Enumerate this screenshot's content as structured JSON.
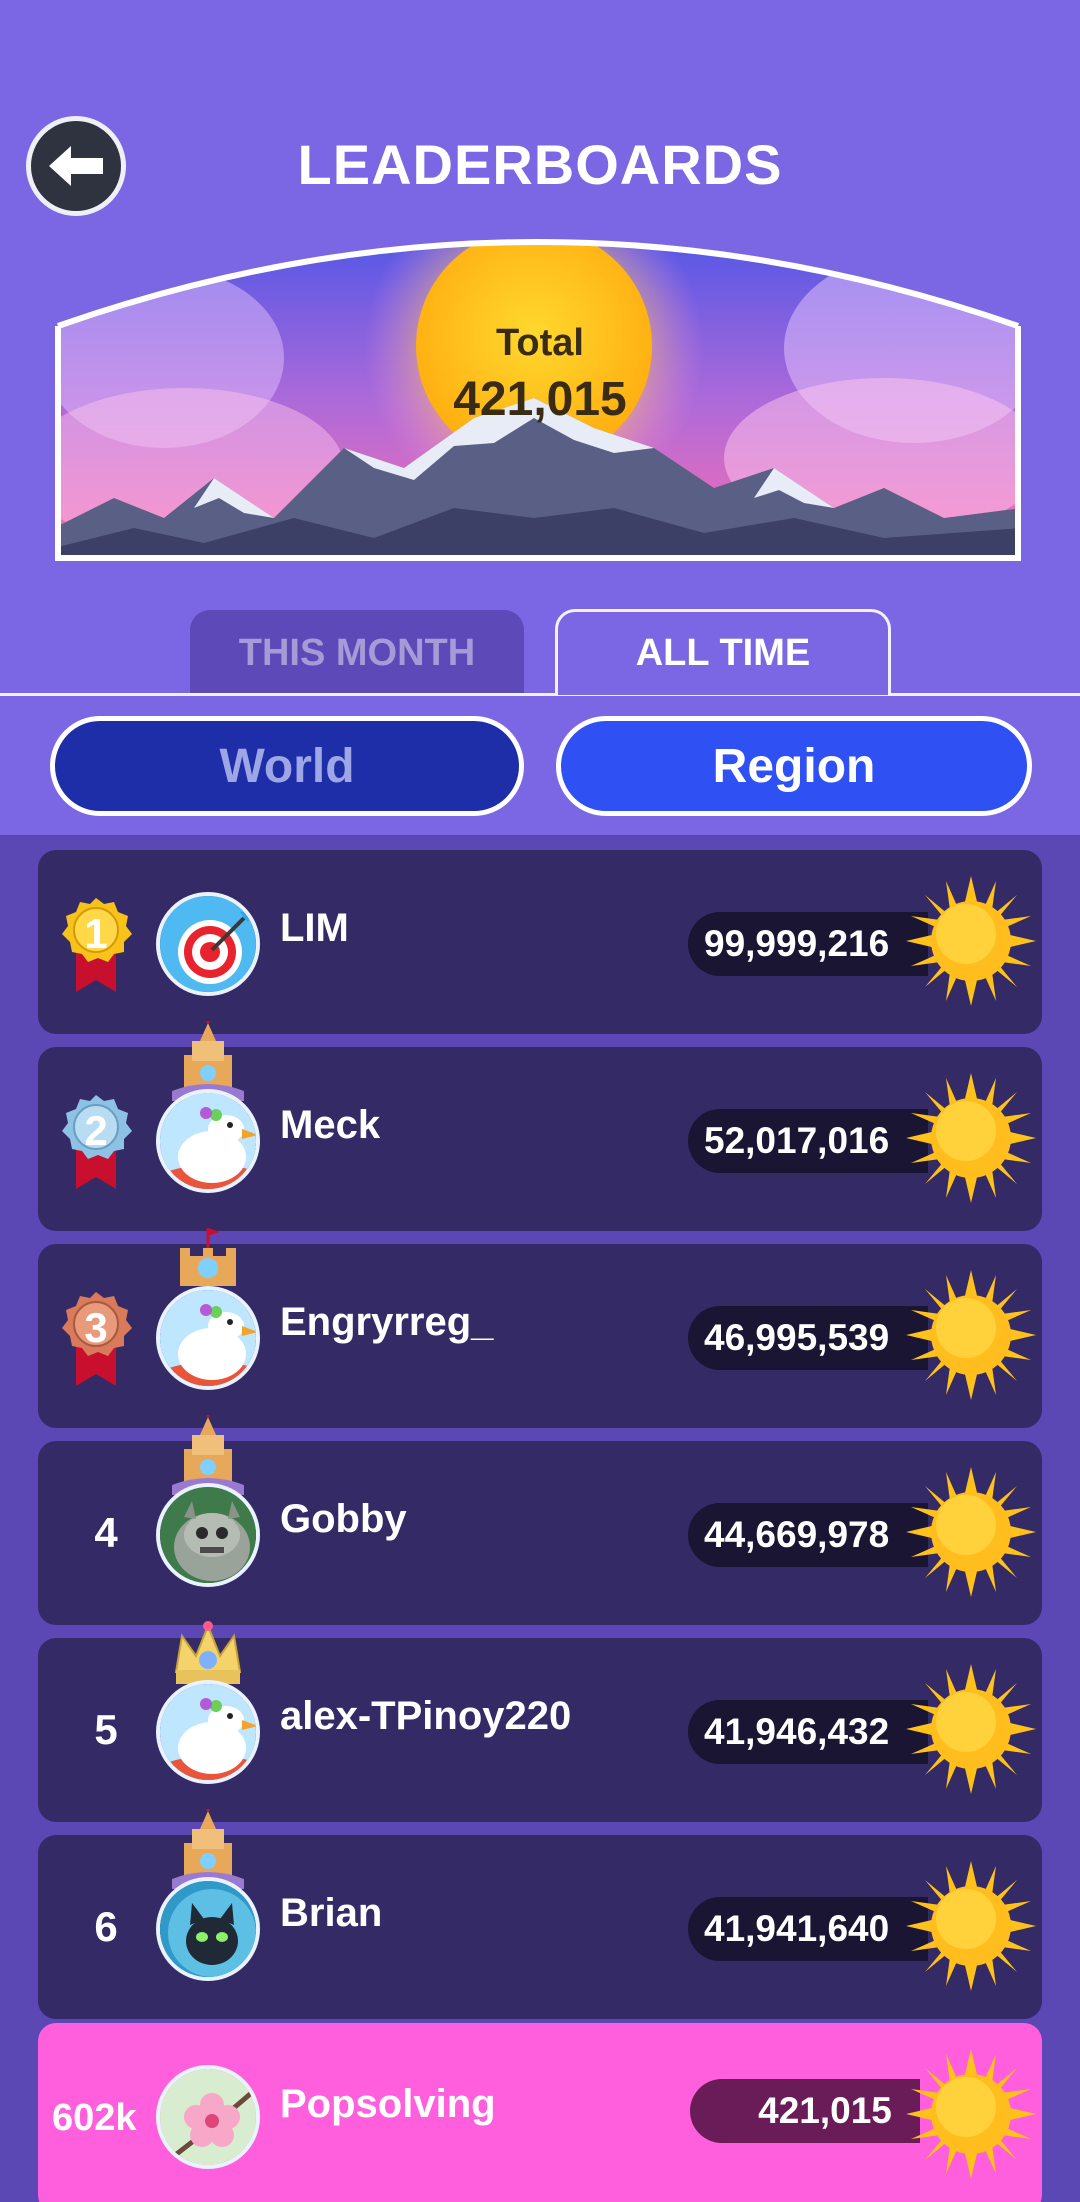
{
  "header": {
    "title": "LEADERBOARDS",
    "total_label": "Total",
    "total_value": "421,015"
  },
  "tabs": [
    {
      "label": "THIS MONTH",
      "active": false
    },
    {
      "label": "ALL TIME",
      "active": true
    }
  ],
  "scope": [
    {
      "label": "World",
      "active": false
    },
    {
      "label": "Region",
      "active": true
    }
  ],
  "entries": [
    {
      "rank": "1",
      "name": "LIM",
      "score": "99,999,216",
      "medal": "gold",
      "avatar": "target-avatar"
    },
    {
      "rank": "2",
      "name": "Meck",
      "score": "52,017,016",
      "medal": "silver",
      "avatar": "bird-avatar"
    },
    {
      "rank": "3",
      "name": "Engryrreg_",
      "score": "46,995,539",
      "medal": "bronze",
      "avatar": "bird-avatar"
    },
    {
      "rank": "4",
      "name": "Gobby",
      "score": "44,669,978",
      "medal": "",
      "avatar": "gargoyle-avatar"
    },
    {
      "rank": "5",
      "name": "alex-TPinoy220",
      "score": "41,946,432",
      "medal": "",
      "avatar": "bird-avatar"
    },
    {
      "rank": "6",
      "name": "Brian",
      "score": "41,941,640",
      "medal": "",
      "avatar": "cat-avatar"
    }
  ],
  "me": {
    "rank": "602k",
    "name": "Popsolving",
    "score": "421,015",
    "avatar": "blossom-avatar"
  },
  "colors": {
    "background": "#7b66e4",
    "list_background": "#5b48b5",
    "row": "#342a65",
    "me_row": "#ff5fdc",
    "region_button": "#2f50f2",
    "world_button": "#1d2ea8"
  }
}
